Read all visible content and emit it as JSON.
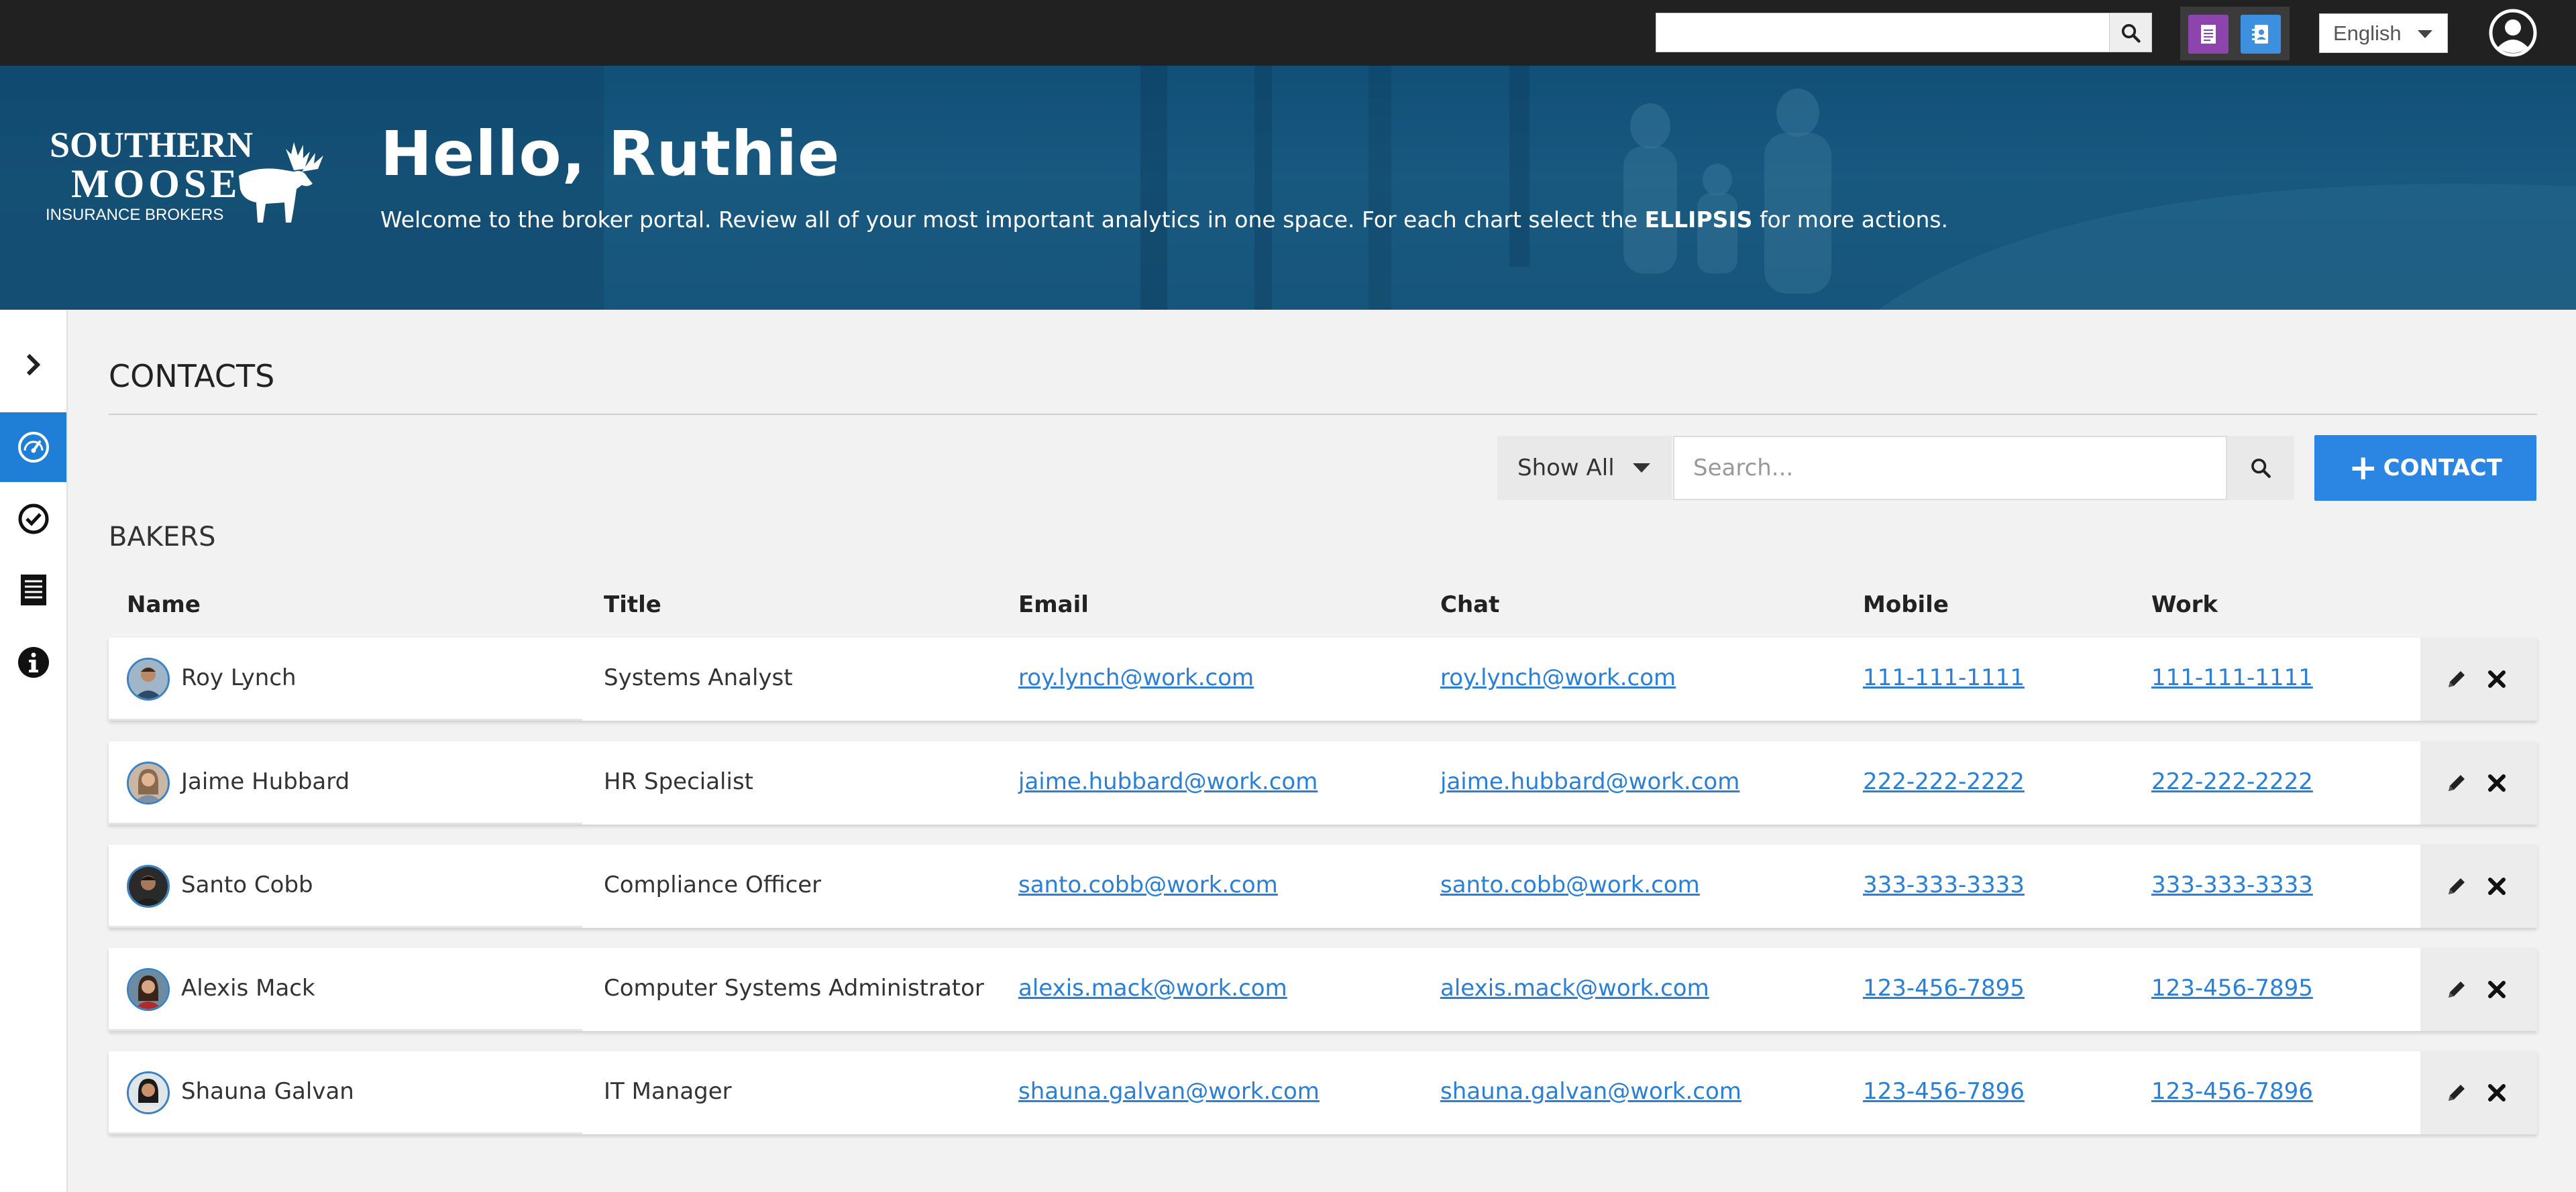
{
  "topbar": {
    "search_value": "",
    "language": "English",
    "tools": [
      "document-icon",
      "contact-card-icon"
    ]
  },
  "hero": {
    "logo": {
      "line1": "SOUTHERN",
      "line2": "MOOSE",
      "line3": "INSURANCE BROKERS"
    },
    "greeting": "Hello, Ruthie",
    "welcome_pre": "Welcome to the broker portal. Review all of your most important analytics in one space. For each chart select the ",
    "welcome_bold": "ELLIPSIS",
    "welcome_post": " for more actions."
  },
  "sidebar": {
    "items": [
      "chevron-right-icon",
      "dashboard-icon",
      "check-circle-icon",
      "document-list-icon",
      "info-icon"
    ],
    "active": "dashboard-icon"
  },
  "contacts": {
    "title": "CONTACTS",
    "filter_value": "Show All",
    "search_placeholder": "Search...",
    "add_button_label": "CONTACT",
    "group": "BAKERS",
    "columns": [
      "Name",
      "Title",
      "Email",
      "Chat",
      "Mobile",
      "Work"
    ],
    "rows": [
      {
        "name": "Roy Lynch",
        "title": "Systems Analyst",
        "email": "roy.lynch@work.com",
        "chat": "roy.lynch@work.com",
        "mobile": "111-111-1111",
        "work": "111-111-1111"
      },
      {
        "name": "Jaime Hubbard",
        "title": "HR Specialist",
        "email": "jaime.hubbard@work.com",
        "chat": "jaime.hubbard@work.com",
        "mobile": "222-222-2222",
        "work": "222-222-2222"
      },
      {
        "name": "Santo Cobb",
        "title": "Compliance Officer",
        "email": "santo.cobb@work.com",
        "chat": "santo.cobb@work.com",
        "mobile": "333-333-3333",
        "work": "333-333-3333"
      },
      {
        "name": "Alexis Mack",
        "title": "Computer Systems Administrator",
        "email": "alexis.mack@work.com",
        "chat": "alexis.mack@work.com",
        "mobile": "123-456-7895",
        "work": "123-456-7895"
      },
      {
        "name": "Shauna Galvan",
        "title": "IT Manager",
        "email": "shauna.galvan@work.com",
        "chat": "shauna.galvan@work.com",
        "mobile": "123-456-7896",
        "work": "123-456-7896"
      }
    ]
  },
  "colors": {
    "accent": "#2a86e2",
    "link": "#2a7fd6",
    "topbar": "#212121",
    "hero": "#1a5a80",
    "tool_purple": "#8e44ad",
    "tool_blue": "#3d8fe0"
  }
}
